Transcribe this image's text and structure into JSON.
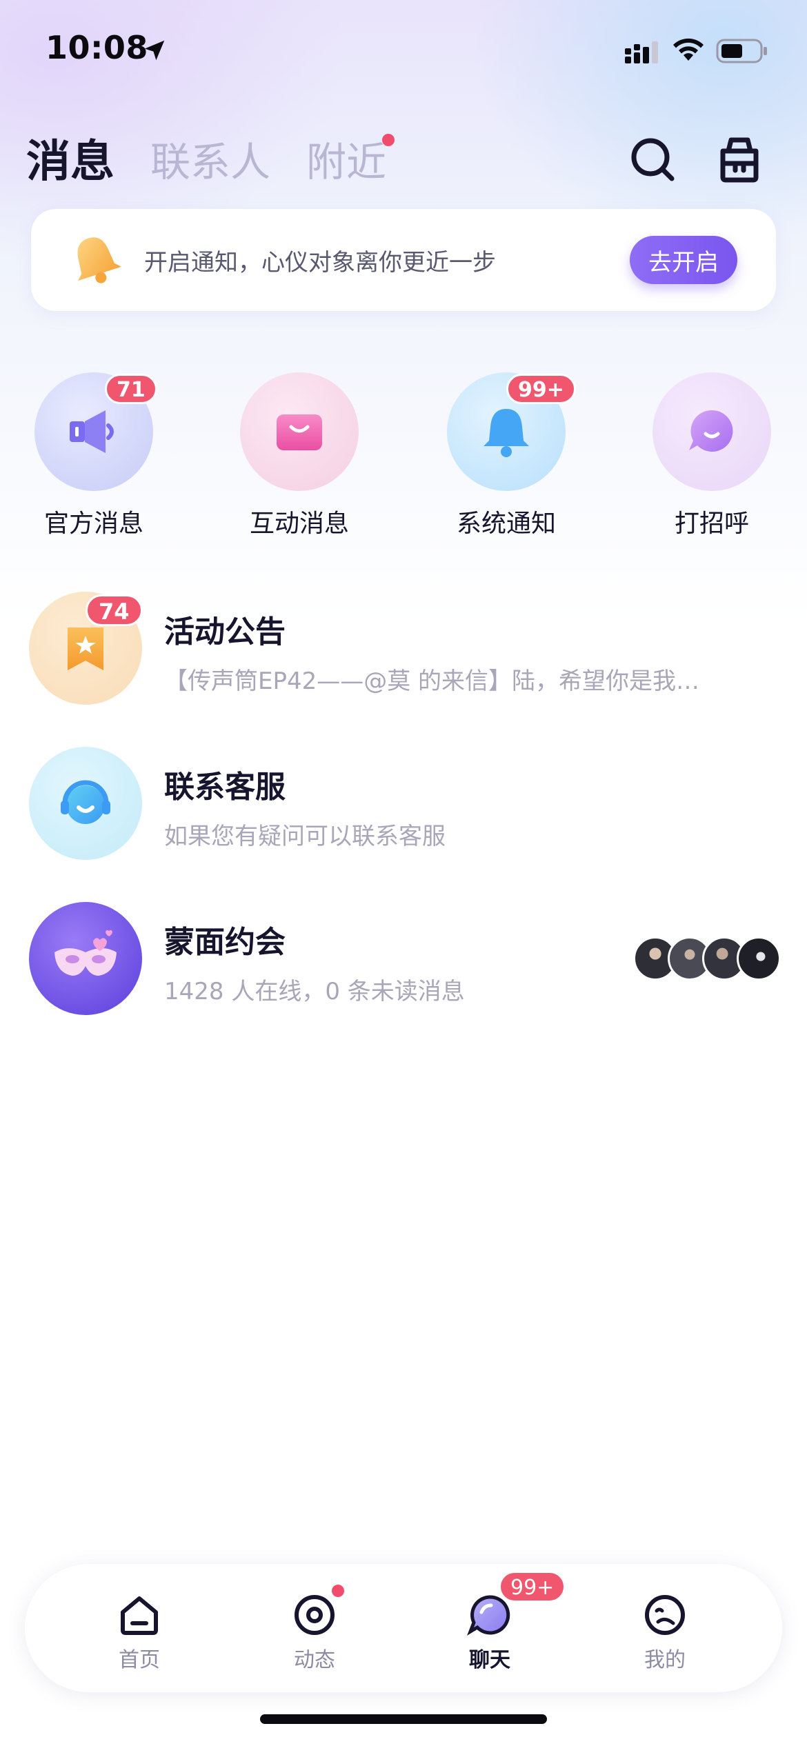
{
  "status_bar": {
    "time": "10:08"
  },
  "header": {
    "tabs": [
      {
        "label": "消息",
        "active": true
      },
      {
        "label": "联系人",
        "active": false
      },
      {
        "label": "附近",
        "active": false,
        "has_dot": true
      }
    ]
  },
  "notify_banner": {
    "text": "开启通知，心仪对象离你更近一步",
    "button_label": "去开启"
  },
  "quick_entries": [
    {
      "label": "官方消息",
      "badge": "71",
      "icon": "megaphone-icon"
    },
    {
      "label": "互动消息",
      "badge": "",
      "icon": "envelope-icon"
    },
    {
      "label": "系统通知",
      "badge": "99+",
      "icon": "bell-icon"
    },
    {
      "label": "打招呼",
      "badge": "",
      "icon": "chat-bubble-icon"
    }
  ],
  "conversations": [
    {
      "title": "活动公告",
      "subtitle": "【传声筒EP42——@莫 的来信】陆，希望你是我…",
      "badge": "74",
      "icon": "star-ribbon-icon"
    },
    {
      "title": "联系客服",
      "subtitle": "如果您有疑问可以联系客服",
      "badge": "",
      "icon": "headset-icon"
    },
    {
      "title": "蒙面约会",
      "subtitle": "1428 人在线，0 条未读消息",
      "badge": "",
      "icon": "mask-icon",
      "online_avatars": 4
    }
  ],
  "bottom_nav": {
    "items": [
      {
        "label": "首页",
        "icon": "home-icon",
        "active": false
      },
      {
        "label": "动态",
        "icon": "moments-icon",
        "active": false,
        "has_dot": true
      },
      {
        "label": "聊天",
        "icon": "chat-icon",
        "active": true,
        "badge": "99+"
      },
      {
        "label": "我的",
        "icon": "profile-icon",
        "active": false
      }
    ]
  },
  "colors": {
    "accent": "#7a56ee",
    "badge": "#f0566e",
    "text_primary": "#17142e",
    "text_secondary": "#a8a6b8"
  }
}
